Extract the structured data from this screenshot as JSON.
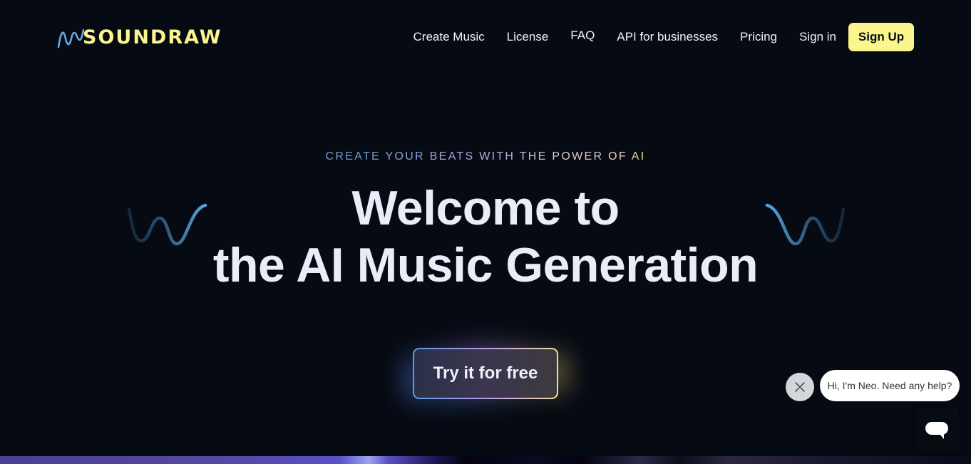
{
  "header": {
    "logo_text": "SOUNDRAW",
    "nav": [
      {
        "label": "Create Music"
      },
      {
        "label": "License"
      },
      {
        "label": "FAQ"
      },
      {
        "label": "API for businesses"
      },
      {
        "label": "Pricing"
      },
      {
        "label": "Sign in"
      }
    ],
    "signup_label": "Sign Up"
  },
  "hero": {
    "eyebrow_parts": [
      "CREATE ",
      "YOUR ",
      "BEATS ",
      "WITH ",
      "THE ",
      "POWER ",
      "OF ",
      "AI"
    ],
    "eyebrow_colors": [
      "#6f9cd0",
      "#8aa2d8",
      "#a3a6dc",
      "#b9addd",
      "#cdbad6",
      "#dcc9c6",
      "#e4d6b4",
      "#ead9a0"
    ],
    "title_line1": "Welcome to",
    "title_line2": "the AI Music Generation",
    "cta_label": "Try it for free"
  },
  "chat": {
    "greeting": "Hi, I'm Neo. Need any help?",
    "close_icon": "close-icon",
    "launcher_icon": "chat-bubble-icon"
  },
  "colors": {
    "background": "#060a12",
    "brand_yellow": "#fbf58e",
    "accent_blue": "#5d9be6"
  }
}
